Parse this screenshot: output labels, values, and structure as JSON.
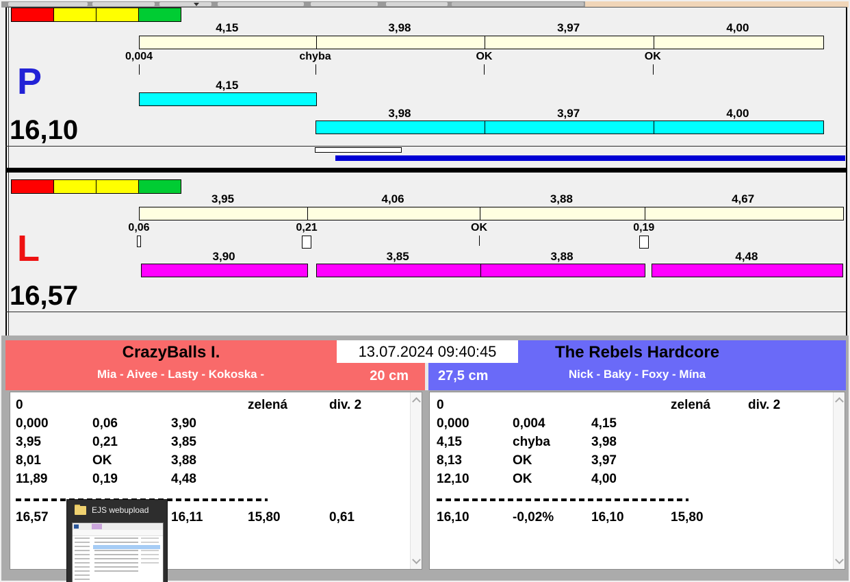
{
  "app": {
    "timestamp": "13.07.2024 09:40:45"
  },
  "legend_colors": [
    "#FF0000",
    "#FFFF00",
    "#FFFF00",
    "#00CC33"
  ],
  "lanes": [
    {
      "id": "P",
      "letter": "P",
      "letter_color": "#2222D6",
      "total": "16,10",
      "bar_color": "#00FFFF",
      "ruler_segments": [
        {
          "label": "4,15",
          "value": 4.15
        },
        {
          "label": "3,98",
          "value": 3.98
        },
        {
          "label": "3,97",
          "value": 3.97
        },
        {
          "label": "4,00",
          "value": 4.0
        }
      ],
      "marks": [
        {
          "label": "0,004",
          "type": "tick",
          "at": 0
        },
        {
          "label": "chyba",
          "type": "tick",
          "at": 4.15
        },
        {
          "label": "OK",
          "type": "tick",
          "at": 8.13
        },
        {
          "label": "OK",
          "type": "tick",
          "at": 12.1
        }
      ],
      "runs": [
        {
          "row": 0,
          "from": 0,
          "segments": [
            {
              "label": "4,15",
              "value": 4.15
            }
          ]
        },
        {
          "row": 1,
          "from": 4.15,
          "segments": [
            {
              "label": "3,98",
              "value": 3.98
            },
            {
              "label": "3,97",
              "value": 3.97
            },
            {
              "label": "4,00",
              "value": 4.0
            }
          ]
        }
      ],
      "underbars": [
        {
          "type": "outline",
          "from": 4.14,
          "to": 6.16
        },
        {
          "type": "solid",
          "color": "#0000D4",
          "from": 4.62,
          "to": 16.63
        }
      ]
    },
    {
      "id": "L",
      "letter": "L",
      "letter_color": "#EE1111",
      "total": "16,57",
      "bar_color": "#FF00FF",
      "ruler_segments": [
        {
          "label": "3,95",
          "value": 3.95
        },
        {
          "label": "4,06",
          "value": 4.06
        },
        {
          "label": "3,88",
          "value": 3.88
        },
        {
          "label": "4,67",
          "value": 4.67
        }
      ],
      "marks": [
        {
          "label": "0,06",
          "type": "slimbox",
          "at": 0
        },
        {
          "label": "0,21",
          "type": "box",
          "at": 3.95
        },
        {
          "label": "OK",
          "type": "tick",
          "at": 8.01
        },
        {
          "label": "0,19",
          "type": "box",
          "at": 11.89
        }
      ],
      "runs": [
        {
          "row": 0,
          "from": 0.05,
          "segments": [
            {
              "label": "3,90",
              "value": 3.9
            }
          ]
        },
        {
          "row": 0,
          "from": 4.17,
          "segments": [
            {
              "label": "3,85",
              "value": 3.85
            },
            {
              "label": "3,88",
              "value": 3.88
            }
          ]
        },
        {
          "row": 0,
          "from": 12.07,
          "segments": [
            {
              "label": "4,48",
              "value": 4.48
            }
          ]
        }
      ],
      "underbars": []
    }
  ],
  "panels": [
    {
      "side": "left",
      "title": "CrazyBalls I.",
      "names": "Mia - Aivee - Lasty - Kokoska -",
      "jump_height": "20 cm",
      "header_color": "#F96A6A",
      "rows": [
        [
          "0",
          "",
          "",
          "zelená",
          "div. 2"
        ],
        [
          "0,000",
          "0,06",
          "3,90",
          "",
          ""
        ],
        [
          "3,95",
          "0,21",
          "3,85",
          "",
          ""
        ],
        [
          "8,01",
          "OK",
          "3,88",
          "",
          ""
        ],
        [
          "11,89",
          "0,19",
          "4,48",
          "",
          ""
        ]
      ],
      "totals": [
        "16,57",
        "",
        "16,11",
        "15,80",
        "0,61"
      ]
    },
    {
      "side": "right",
      "title": "The Rebels Hardcore",
      "names": "Nick - Baky - Foxy - Mína",
      "jump_height": "27,5 cm",
      "header_color": "#6A6AF8",
      "rows": [
        [
          "0",
          "",
          "",
          "zelená",
          "div. 2"
        ],
        [
          "0,000",
          "0,004",
          "4,15",
          "",
          ""
        ],
        [
          "4,15",
          "chyba",
          "3,98",
          "",
          ""
        ],
        [
          "8,13",
          "OK",
          "3,97",
          "",
          ""
        ],
        [
          "12,10",
          "OK",
          "4,00",
          "",
          ""
        ]
      ],
      "totals": [
        "16,10",
        "-0,02%",
        "16,10",
        "15,80",
        ""
      ]
    }
  ],
  "overlay": {
    "title": "EJS webupload"
  }
}
